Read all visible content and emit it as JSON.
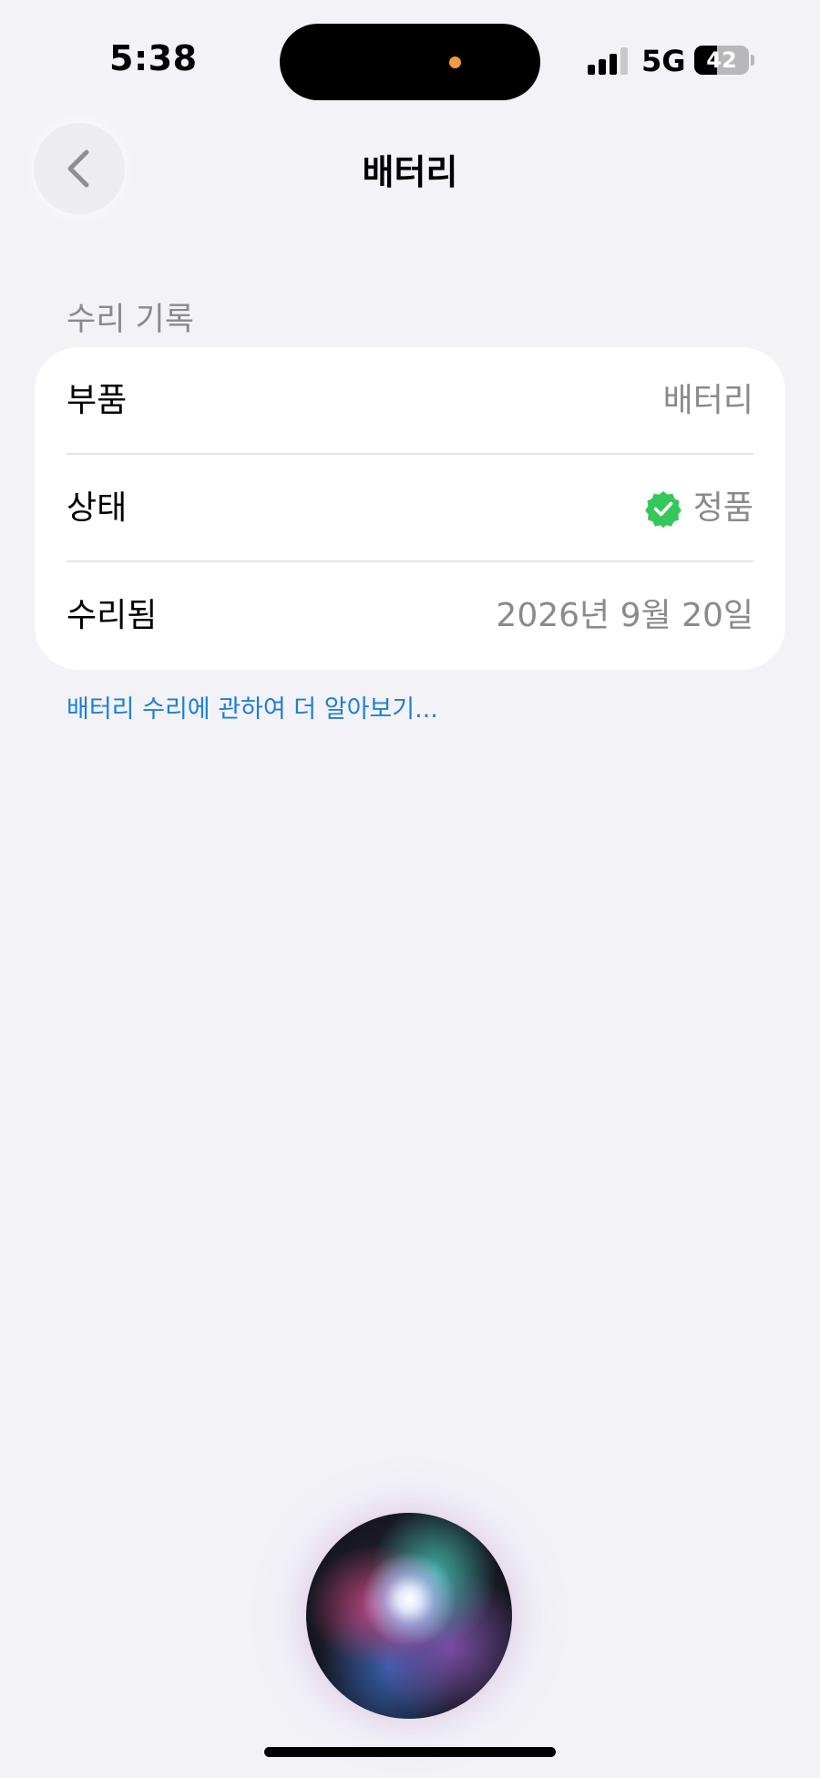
{
  "status_bar": {
    "time": "5:38",
    "network": "5G",
    "battery_percent": 42,
    "battery_label": "42"
  },
  "nav": {
    "title": "배터리",
    "back_icon": "chevron-left-icon"
  },
  "repair_history": {
    "section_title": "수리 기록",
    "rows": [
      {
        "label": "부품",
        "value": "배터리"
      },
      {
        "label": "상태",
        "value": "정품",
        "icon": "verified-badge-icon"
      },
      {
        "label": "수리됨",
        "value": "2026년 9월 20일"
      }
    ],
    "learn_more": "배터리 수리에 관하여 더 알아보기..."
  },
  "colors": {
    "background": "#f2f2f7",
    "card": "#ffffff",
    "secondary_text": "#8a8a8e",
    "link": "#1f7fd6",
    "verified_green": "#34c759"
  }
}
